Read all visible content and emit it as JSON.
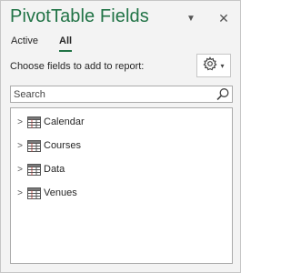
{
  "pane": {
    "title": "PivotTable Fields",
    "menu_icon": "dropdown-triangle-icon",
    "close_icon": "close-icon"
  },
  "tabs": [
    {
      "label": "Active",
      "selected": false
    },
    {
      "label": "All",
      "selected": true
    }
  ],
  "instructions": "Choose fields to add to report:",
  "tools_button": {
    "icon": "gear-icon",
    "caret": "▾"
  },
  "search": {
    "placeholder": "Search",
    "value": "",
    "icon": "search-icon"
  },
  "tables": [
    {
      "label": "Calendar",
      "icon": "table-icon",
      "expanded": false
    },
    {
      "label": "Courses",
      "icon": "table-icon",
      "expanded": false
    },
    {
      "label": "Data",
      "icon": "table-icon",
      "expanded": false
    },
    {
      "label": "Venues",
      "icon": "table-icon",
      "expanded": false
    }
  ],
  "colors": {
    "title": "#217346",
    "active_tab_underline": "#217346",
    "pane_background": "#f3f3f3",
    "border": "#ababab"
  }
}
